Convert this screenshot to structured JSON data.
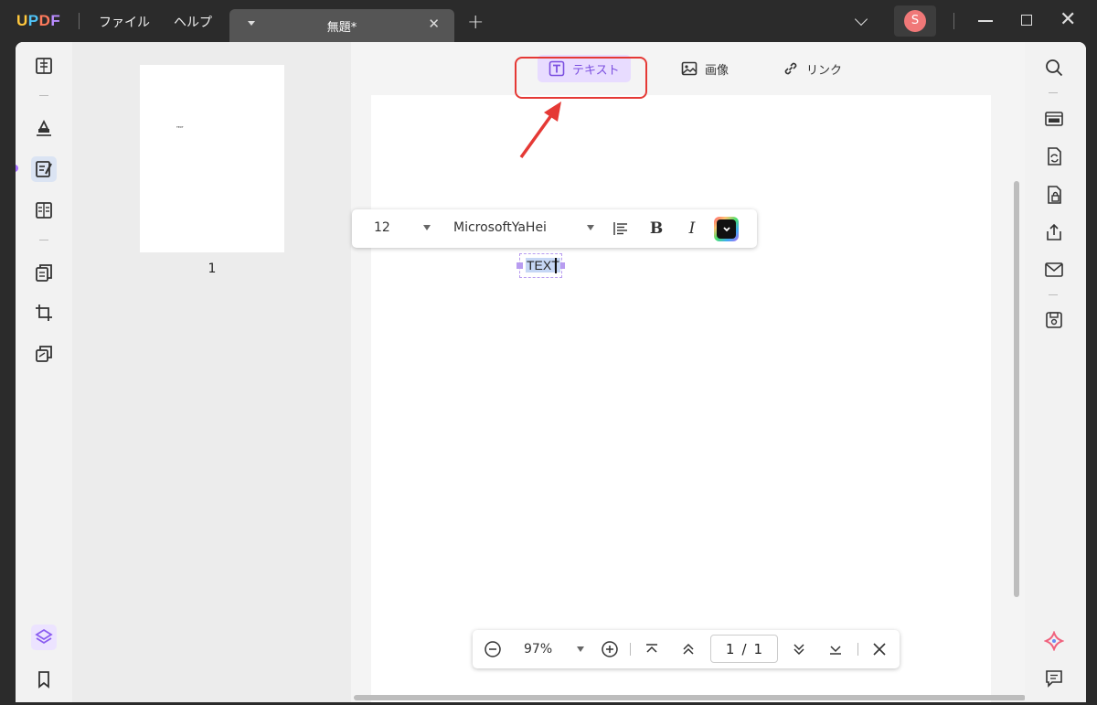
{
  "app": {
    "logo": [
      "U",
      "P",
      "D",
      "F"
    ],
    "menu": {
      "file": "ファイル",
      "help": "ヘルプ"
    },
    "tab": {
      "title": "無題*",
      "close": "✕"
    },
    "new_tab": "+",
    "user_initial": "S",
    "close_glyph": "✕"
  },
  "edit_toolbar": {
    "text_label": "テキスト",
    "image_label": "画像",
    "link_label": "リンク",
    "active": "text"
  },
  "thumbnail": {
    "page_number": "1",
    "text": "TEXT"
  },
  "format_toolbar": {
    "font_size": "12",
    "font_name": "MicrosoftYaHei",
    "bold_label": "B",
    "italic_label": "I",
    "text_color": "#000000"
  },
  "text_object": {
    "content": "TEXT"
  },
  "zoom_bar": {
    "zoom": "97%",
    "current_page": "1",
    "separator": "/",
    "total_pages": "1"
  },
  "colors": {
    "accent": "#a36cff",
    "highlight_box": "#e53935",
    "titlebar": "#2b2b2b"
  }
}
